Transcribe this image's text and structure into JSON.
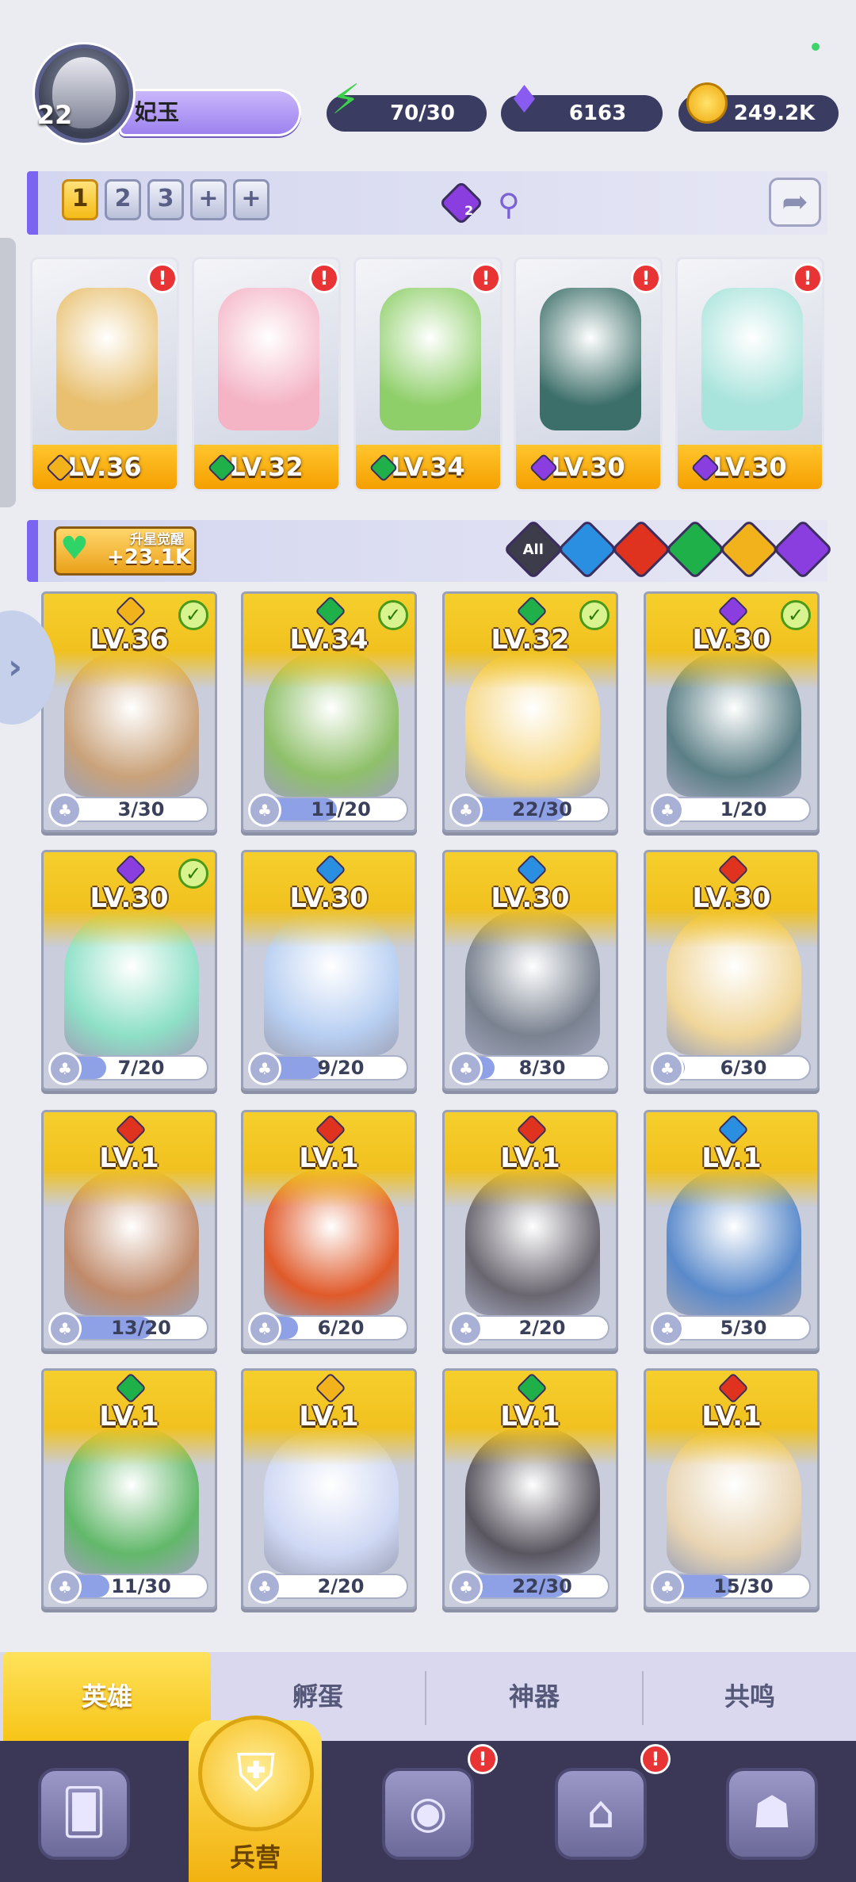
{
  "player": {
    "level": "22",
    "name": "妃玉"
  },
  "resources": {
    "energy": "70/30",
    "gems": "6163",
    "gold": "249.2K"
  },
  "team_tabs": [
    "1",
    "2",
    "3"
  ],
  "team_add": "+",
  "team_selected_icon_count": "2",
  "lineup": [
    {
      "level": "LV.36",
      "element": "light",
      "color": "#e8c070"
    },
    {
      "level": "LV.32",
      "element": "nature",
      "color": "#f4b4c6"
    },
    {
      "level": "LV.34",
      "element": "nature",
      "color": "#8fcf6a"
    },
    {
      "level": "LV.30",
      "element": "dark",
      "color": "#3d6f6a"
    },
    {
      "level": "LV.30",
      "element": "dark",
      "color": "#a8e3dc"
    }
  ],
  "awaken": {
    "title": "升星觉醒",
    "value": "+23.1K"
  },
  "element_filters": [
    {
      "name": "all",
      "label": "All",
      "color": "#3c3c4a"
    },
    {
      "name": "water",
      "label": "",
      "color": "#2a8fe0"
    },
    {
      "name": "fire",
      "label": "",
      "color": "#e0331f"
    },
    {
      "name": "nature",
      "label": "",
      "color": "#1fb04a"
    },
    {
      "name": "light",
      "label": "",
      "color": "#f2b21c"
    },
    {
      "name": "dark",
      "label": "",
      "color": "#8a3ee0"
    }
  ],
  "element_colors": {
    "light": "#f2b21c",
    "nature": "#1fb04a",
    "dark": "#8a3ee0",
    "water": "#2a8fe0",
    "fire": "#e0331f"
  },
  "heroes": [
    {
      "level": "LV.36",
      "element": "light",
      "shards": "3/30",
      "progress": 0.1,
      "checked": true,
      "color": "#c9a27a"
    },
    {
      "level": "LV.34",
      "element": "nature",
      "shards": "11/20",
      "progress": 0.55,
      "checked": true,
      "color": "#8fc06a"
    },
    {
      "level": "LV.32",
      "element": "nature",
      "shards": "22/30",
      "progress": 0.73,
      "checked": true,
      "color": "#f6d98a"
    },
    {
      "level": "LV.30",
      "element": "dark",
      "shards": "1/20",
      "progress": 0.05,
      "checked": true,
      "color": "#5b7f86"
    },
    {
      "level": "LV.30",
      "element": "dark",
      "shards": "7/20",
      "progress": 0.35,
      "checked": true,
      "color": "#8ee0c6"
    },
    {
      "level": "LV.30",
      "element": "water",
      "shards": "9/20",
      "progress": 0.45,
      "checked": false,
      "color": "#b8cff2"
    },
    {
      "level": "LV.30",
      "element": "water",
      "shards": "8/30",
      "progress": 0.27,
      "checked": false,
      "color": "#7a8290"
    },
    {
      "level": "LV.30",
      "element": "fire",
      "shards": "6/30",
      "progress": 0.2,
      "checked": false,
      "color": "#f0d69a"
    },
    {
      "level": "LV.1",
      "element": "fire",
      "shards": "13/20",
      "progress": 0.65,
      "checked": false,
      "color": "#c08a6a"
    },
    {
      "level": "LV.1",
      "element": "fire",
      "shards": "6/20",
      "progress": 0.3,
      "checked": false,
      "color": "#e05a2a"
    },
    {
      "level": "LV.1",
      "element": "fire",
      "shards": "2/20",
      "progress": 0.1,
      "checked": false,
      "color": "#6a6670"
    },
    {
      "level": "LV.1",
      "element": "water",
      "shards": "5/30",
      "progress": 0.17,
      "checked": false,
      "color": "#5a8acb"
    },
    {
      "level": "LV.1",
      "element": "nature",
      "shards": "11/30",
      "progress": 0.37,
      "checked": false,
      "color": "#62b86a"
    },
    {
      "level": "LV.1",
      "element": "light",
      "shards": "2/20",
      "progress": 0.1,
      "checked": false,
      "color": "#cfd8f4"
    },
    {
      "level": "LV.1",
      "element": "nature",
      "shards": "22/30",
      "progress": 0.73,
      "checked": false,
      "color": "#5a5660"
    },
    {
      "level": "LV.1",
      "element": "fire",
      "shards": "15/30",
      "progress": 0.5,
      "checked": false,
      "color": "#e8d4b2"
    }
  ],
  "sub_tabs": [
    "英雄",
    "孵蛋",
    "神器",
    "共鸣"
  ],
  "nav": {
    "active_label": "兵营"
  }
}
